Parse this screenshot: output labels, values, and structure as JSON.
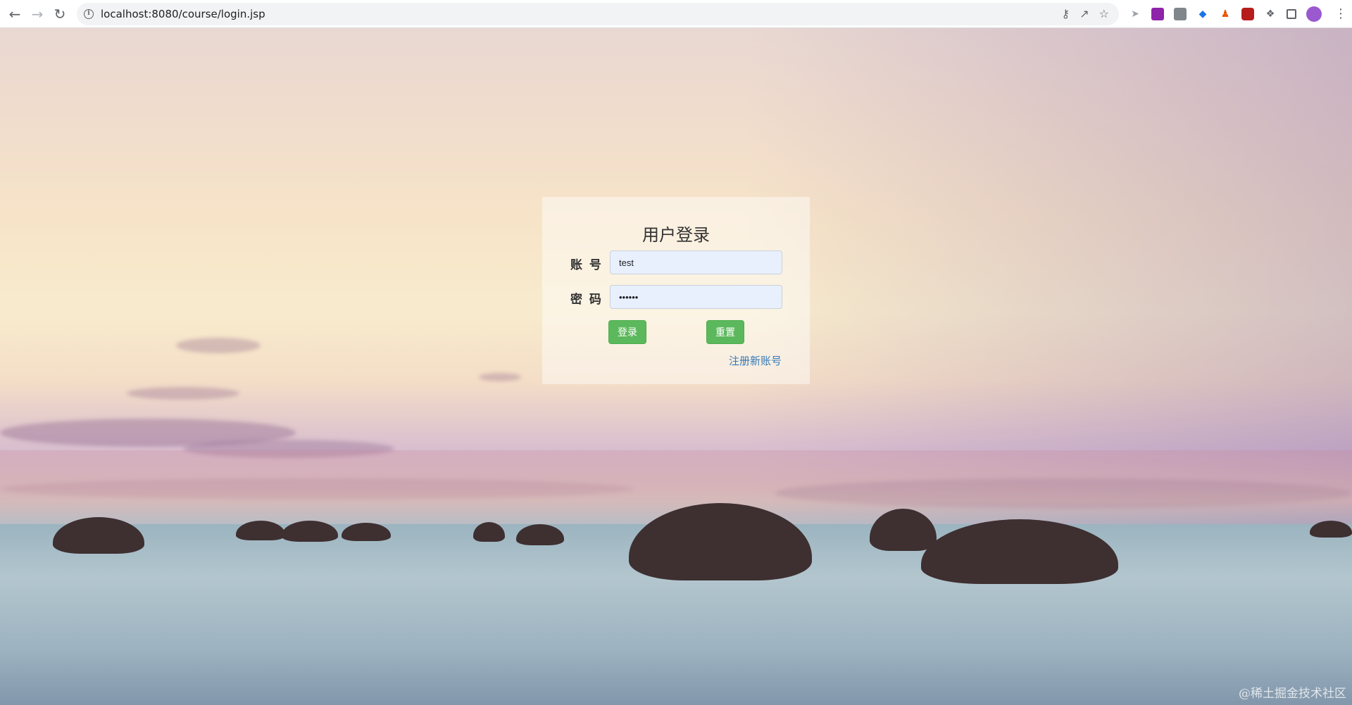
{
  "browser": {
    "url": "localhost:8080/course/login.jsp",
    "back_icon": "arrow-left",
    "forward_icon": "arrow-right",
    "reload_icon": "refresh"
  },
  "login": {
    "title": "用户登录",
    "account_label": "账 号",
    "account_value": "test",
    "password_label": "密 码",
    "password_value": "••••••",
    "login_button": "登录",
    "reset_button": "重置",
    "register_link": "注册新账号"
  },
  "colors": {
    "button_green": "#5cb85c",
    "link_blue": "#337ab7",
    "input_autofill": "#e8f0fe"
  },
  "watermark": "@稀土掘金技术社区"
}
